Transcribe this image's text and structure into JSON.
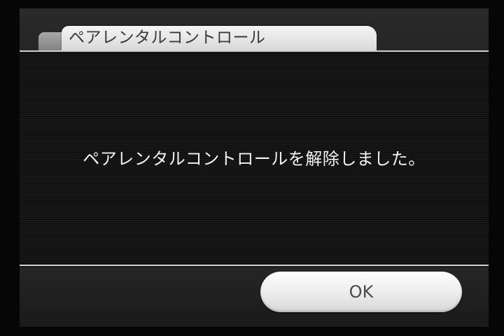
{
  "dialog": {
    "title": "ペアレンタルコントロール",
    "message": "ペアレンタルコントロールを解除しました。",
    "ok_label": "OK"
  },
  "colors": {
    "background": "#060606",
    "panel": "#1c1c1c",
    "tab": "#e6e6e6",
    "divider": "#cfcfcf",
    "text_light": "#f2f2f2",
    "text_dark": "#3a3a3a"
  }
}
